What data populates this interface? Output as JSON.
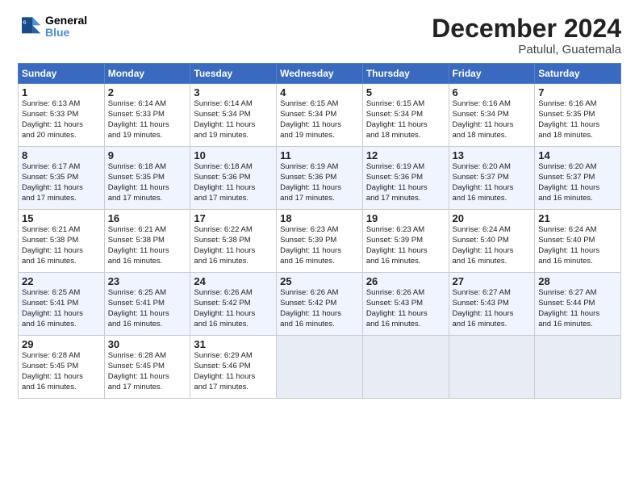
{
  "header": {
    "logo_line1": "General",
    "logo_line2": "Blue",
    "title": "December 2024",
    "subtitle": "Patulul, Guatemala"
  },
  "days_of_week": [
    "Sunday",
    "Monday",
    "Tuesday",
    "Wednesday",
    "Thursday",
    "Friday",
    "Saturday"
  ],
  "weeks": [
    [
      {
        "day": "1",
        "lines": [
          "Sunrise: 6:13 AM",
          "Sunset: 5:33 PM",
          "Daylight: 11 hours",
          "and 20 minutes."
        ]
      },
      {
        "day": "2",
        "lines": [
          "Sunrise: 6:14 AM",
          "Sunset: 5:33 PM",
          "Daylight: 11 hours",
          "and 19 minutes."
        ]
      },
      {
        "day": "3",
        "lines": [
          "Sunrise: 6:14 AM",
          "Sunset: 5:34 PM",
          "Daylight: 11 hours",
          "and 19 minutes."
        ]
      },
      {
        "day": "4",
        "lines": [
          "Sunrise: 6:15 AM",
          "Sunset: 5:34 PM",
          "Daylight: 11 hours",
          "and 19 minutes."
        ]
      },
      {
        "day": "5",
        "lines": [
          "Sunrise: 6:15 AM",
          "Sunset: 5:34 PM",
          "Daylight: 11 hours",
          "and 18 minutes."
        ]
      },
      {
        "day": "6",
        "lines": [
          "Sunrise: 6:16 AM",
          "Sunset: 5:34 PM",
          "Daylight: 11 hours",
          "and 18 minutes."
        ]
      },
      {
        "day": "7",
        "lines": [
          "Sunrise: 6:16 AM",
          "Sunset: 5:35 PM",
          "Daylight: 11 hours",
          "and 18 minutes."
        ]
      }
    ],
    [
      {
        "day": "8",
        "lines": [
          "Sunrise: 6:17 AM",
          "Sunset: 5:35 PM",
          "Daylight: 11 hours",
          "and 17 minutes."
        ]
      },
      {
        "day": "9",
        "lines": [
          "Sunrise: 6:18 AM",
          "Sunset: 5:35 PM",
          "Daylight: 11 hours",
          "and 17 minutes."
        ]
      },
      {
        "day": "10",
        "lines": [
          "Sunrise: 6:18 AM",
          "Sunset: 5:36 PM",
          "Daylight: 11 hours",
          "and 17 minutes."
        ]
      },
      {
        "day": "11",
        "lines": [
          "Sunrise: 6:19 AM",
          "Sunset: 5:36 PM",
          "Daylight: 11 hours",
          "and 17 minutes."
        ]
      },
      {
        "day": "12",
        "lines": [
          "Sunrise: 6:19 AM",
          "Sunset: 5:36 PM",
          "Daylight: 11 hours",
          "and 17 minutes."
        ]
      },
      {
        "day": "13",
        "lines": [
          "Sunrise: 6:20 AM",
          "Sunset: 5:37 PM",
          "Daylight: 11 hours",
          "and 16 minutes."
        ]
      },
      {
        "day": "14",
        "lines": [
          "Sunrise: 6:20 AM",
          "Sunset: 5:37 PM",
          "Daylight: 11 hours",
          "and 16 minutes."
        ]
      }
    ],
    [
      {
        "day": "15",
        "lines": [
          "Sunrise: 6:21 AM",
          "Sunset: 5:38 PM",
          "Daylight: 11 hours",
          "and 16 minutes."
        ]
      },
      {
        "day": "16",
        "lines": [
          "Sunrise: 6:21 AM",
          "Sunset: 5:38 PM",
          "Daylight: 11 hours",
          "and 16 minutes."
        ]
      },
      {
        "day": "17",
        "lines": [
          "Sunrise: 6:22 AM",
          "Sunset: 5:38 PM",
          "Daylight: 11 hours",
          "and 16 minutes."
        ]
      },
      {
        "day": "18",
        "lines": [
          "Sunrise: 6:23 AM",
          "Sunset: 5:39 PM",
          "Daylight: 11 hours",
          "and 16 minutes."
        ]
      },
      {
        "day": "19",
        "lines": [
          "Sunrise: 6:23 AM",
          "Sunset: 5:39 PM",
          "Daylight: 11 hours",
          "and 16 minutes."
        ]
      },
      {
        "day": "20",
        "lines": [
          "Sunrise: 6:24 AM",
          "Sunset: 5:40 PM",
          "Daylight: 11 hours",
          "and 16 minutes."
        ]
      },
      {
        "day": "21",
        "lines": [
          "Sunrise: 6:24 AM",
          "Sunset: 5:40 PM",
          "Daylight: 11 hours",
          "and 16 minutes."
        ]
      }
    ],
    [
      {
        "day": "22",
        "lines": [
          "Sunrise: 6:25 AM",
          "Sunset: 5:41 PM",
          "Daylight: 11 hours",
          "and 16 minutes."
        ]
      },
      {
        "day": "23",
        "lines": [
          "Sunrise: 6:25 AM",
          "Sunset: 5:41 PM",
          "Daylight: 11 hours",
          "and 16 minutes."
        ]
      },
      {
        "day": "24",
        "lines": [
          "Sunrise: 6:26 AM",
          "Sunset: 5:42 PM",
          "Daylight: 11 hours",
          "and 16 minutes."
        ]
      },
      {
        "day": "25",
        "lines": [
          "Sunrise: 6:26 AM",
          "Sunset: 5:42 PM",
          "Daylight: 11 hours",
          "and 16 minutes."
        ]
      },
      {
        "day": "26",
        "lines": [
          "Sunrise: 6:26 AM",
          "Sunset: 5:43 PM",
          "Daylight: 11 hours",
          "and 16 minutes."
        ]
      },
      {
        "day": "27",
        "lines": [
          "Sunrise: 6:27 AM",
          "Sunset: 5:43 PM",
          "Daylight: 11 hours",
          "and 16 minutes."
        ]
      },
      {
        "day": "28",
        "lines": [
          "Sunrise: 6:27 AM",
          "Sunset: 5:44 PM",
          "Daylight: 11 hours",
          "and 16 minutes."
        ]
      }
    ],
    [
      {
        "day": "29",
        "lines": [
          "Sunrise: 6:28 AM",
          "Sunset: 5:45 PM",
          "Daylight: 11 hours",
          "and 16 minutes."
        ]
      },
      {
        "day": "30",
        "lines": [
          "Sunrise: 6:28 AM",
          "Sunset: 5:45 PM",
          "Daylight: 11 hours",
          "and 17 minutes."
        ]
      },
      {
        "day": "31",
        "lines": [
          "Sunrise: 6:29 AM",
          "Sunset: 5:46 PM",
          "Daylight: 11 hours",
          "and 17 minutes."
        ]
      },
      {
        "day": "",
        "lines": []
      },
      {
        "day": "",
        "lines": []
      },
      {
        "day": "",
        "lines": []
      },
      {
        "day": "",
        "lines": []
      }
    ]
  ]
}
